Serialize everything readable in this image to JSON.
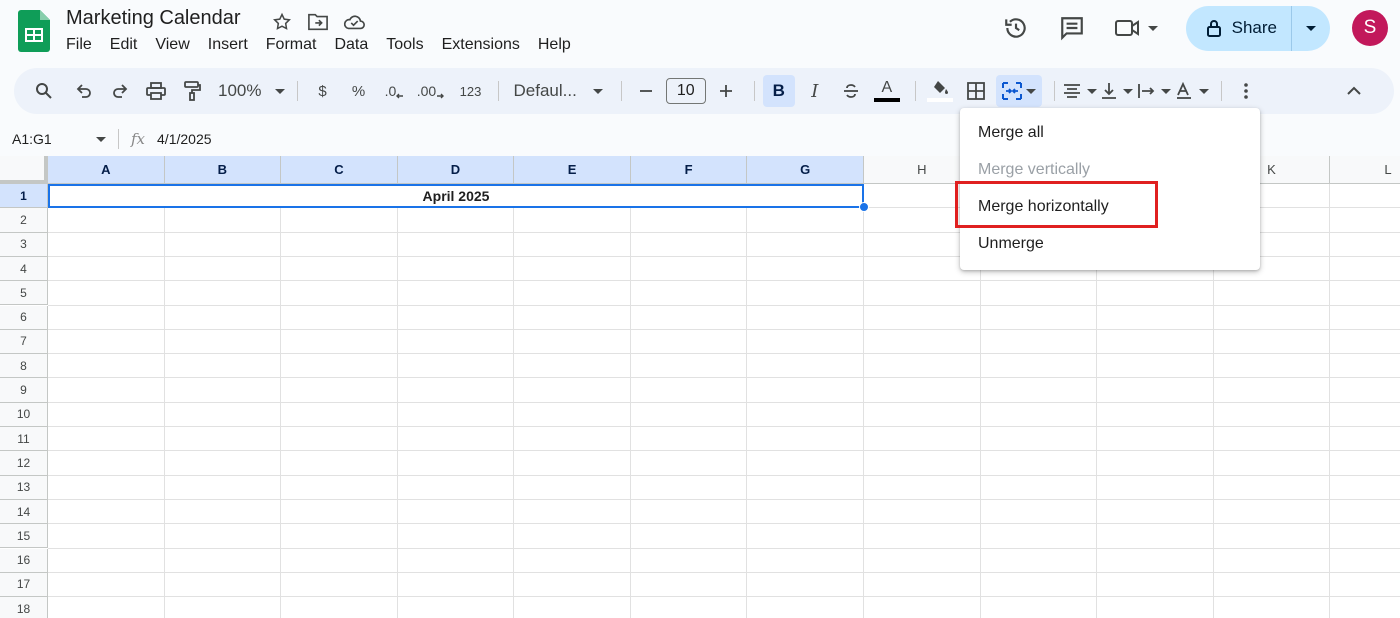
{
  "app": {
    "doc_title": "Marketing Calendar",
    "menus": [
      "File",
      "Edit",
      "View",
      "Insert",
      "Format",
      "Data",
      "Tools",
      "Extensions",
      "Help"
    ],
    "share_label": "Share",
    "avatar_initial": "S",
    "brand_color": "#0f9d58"
  },
  "toolbar": {
    "zoom": "100%",
    "currency": "$",
    "percent": "%",
    "dec_decrease": ".0",
    "dec_increase": ".00",
    "number_format": "123",
    "font": "Defaul...",
    "font_size": "10",
    "bold": "B",
    "italic": "I",
    "text_color": "A"
  },
  "formula": {
    "range": "A1:G1",
    "fx": "fx",
    "value": "4/1/2025"
  },
  "grid": {
    "columns": [
      "A",
      "B",
      "C",
      "D",
      "E",
      "F",
      "G",
      "H",
      "",
      "",
      "K",
      "L"
    ],
    "rows": [
      "1",
      "2",
      "3",
      "4",
      "5",
      "6",
      "7",
      "8",
      "9",
      "10",
      "11",
      "12",
      "13",
      "14",
      "15",
      "16",
      "17",
      "18"
    ],
    "merged_value": "April 2025"
  },
  "merge_menu": {
    "items": [
      {
        "label": "Merge all",
        "enabled": true
      },
      {
        "label": "Merge vertically",
        "enabled": false
      },
      {
        "label": "Merge horizontally",
        "enabled": true
      },
      {
        "label": "Unmerge",
        "enabled": true
      }
    ]
  }
}
